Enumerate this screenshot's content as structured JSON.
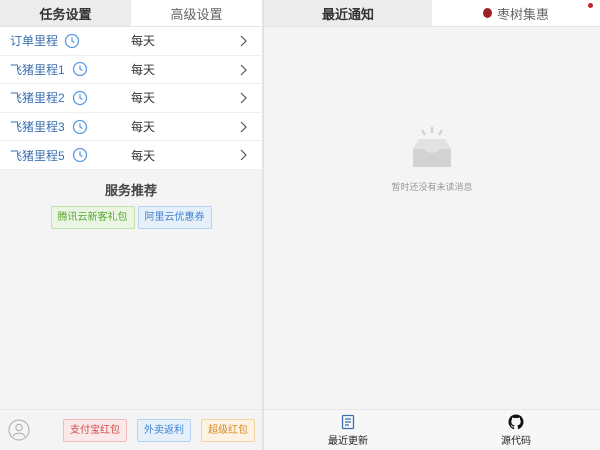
{
  "left_tabs": [
    "任务设置",
    "高级设置"
  ],
  "tasks": [
    {
      "name": "订单里程",
      "frequency": "每天"
    },
    {
      "name": "飞猪里程1",
      "frequency": "每天"
    },
    {
      "name": "飞猪里程2",
      "frequency": "每天"
    },
    {
      "name": "飞猪里程3",
      "frequency": "每天"
    },
    {
      "name": "飞猪里程5",
      "frequency": "每天"
    }
  ],
  "services": {
    "title": "服务推荐",
    "buttons": [
      "腾讯云新客礼包",
      "阿里云优惠券"
    ]
  },
  "left_footer": {
    "buttons": [
      "支付宝红包",
      "外卖返利",
      "超级红包"
    ]
  },
  "right_tabs": [
    "最近通知",
    "枣树集惠"
  ],
  "empty_message": "暂时还没有未读消息",
  "right_footer": [
    "最近更新",
    "源代码"
  ],
  "colors": {
    "accent_blue": "#3a6fb0",
    "brand_red": "#9e1e27"
  }
}
